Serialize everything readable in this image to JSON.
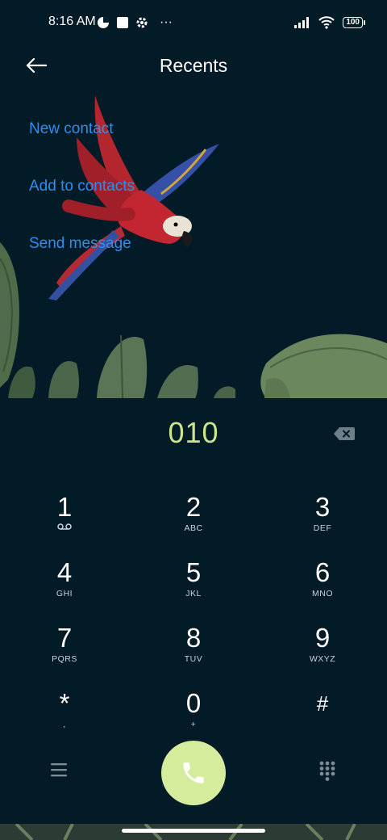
{
  "status_bar": {
    "time": "8:16 AM",
    "more_dots": "···",
    "battery_level": "100"
  },
  "header": {
    "title": "Recents",
    "back_icon": "back-arrow-icon"
  },
  "actions": [
    {
      "label": "New contact"
    },
    {
      "label": "Add to contacts"
    },
    {
      "label": "Send message"
    }
  ],
  "dialer": {
    "number": "010",
    "number_color": "#cde58a",
    "keys": [
      {
        "digit": "1",
        "letters": ""
      },
      {
        "digit": "2",
        "letters": "ABC"
      },
      {
        "digit": "3",
        "letters": "DEF"
      },
      {
        "digit": "4",
        "letters": "GHI"
      },
      {
        "digit": "5",
        "letters": "JKL"
      },
      {
        "digit": "6",
        "letters": "MNO"
      },
      {
        "digit": "7",
        "letters": "PQRS"
      },
      {
        "digit": "8",
        "letters": "TUV"
      },
      {
        "digit": "9",
        "letters": "WXYZ"
      },
      {
        "digit": "*",
        "letters": ","
      },
      {
        "digit": "0",
        "letters": "+"
      },
      {
        "digit": "#",
        "letters": ""
      }
    ]
  },
  "colors": {
    "background": "#031a27",
    "accent_link": "#2d8ff0",
    "call_button": "#d4ec9c"
  }
}
